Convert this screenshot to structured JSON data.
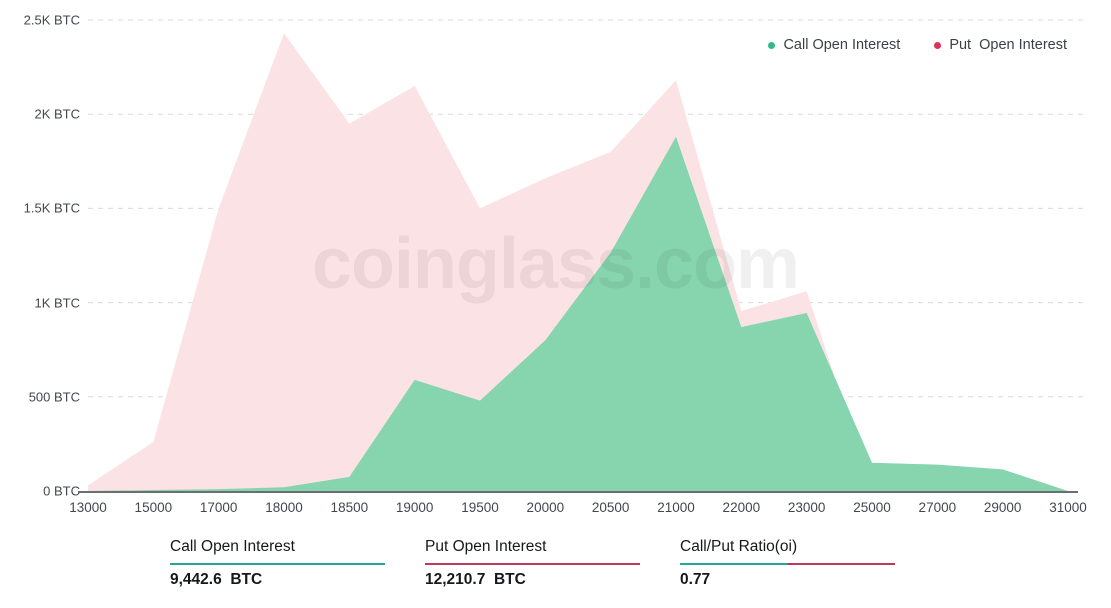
{
  "legend": {
    "items": [
      {
        "label": "Call Open Interest",
        "color": "#2ebd85",
        "icon": "dot-icon"
      },
      {
        "label": "Put  Open Interest",
        "color": "#e0315b",
        "icon": "dot-icon"
      }
    ]
  },
  "watermark": {
    "text": "coinglass.com"
  },
  "stats": [
    {
      "title": "Call Open Interest",
      "value": "9,442.6  BTC",
      "rule": "teal"
    },
    {
      "title": "Put Open Interest",
      "value": "12,210.7  BTC",
      "rule": "crimson"
    },
    {
      "title": "Call/Put Ratio(oi)",
      "value": "0.77",
      "rule": "split"
    }
  ],
  "colors": {
    "call_fill": "#86d5ae",
    "put_fill": "#fbe2e5",
    "call_accent": "#2ebd85",
    "put_accent": "#e0315b",
    "grid": "#d9d9d9",
    "axis": "#3c3f45",
    "teal_rule": "#26a69a",
    "crimson_rule": "#c0395a"
  },
  "chart_data": {
    "type": "area",
    "title": "",
    "xlabel": "",
    "ylabel": "",
    "grid": true,
    "legend_position": "top-right",
    "ylim": [
      0,
      2500
    ],
    "yticks": [
      0,
      500,
      1000,
      1500,
      2000,
      2500
    ],
    "ytick_labels": [
      "0 BTC",
      "500 BTC",
      "1K BTC",
      "1.5K BTC",
      "2K BTC",
      "2.5K BTC"
    ],
    "unit": "BTC",
    "categories": [
      "13000",
      "15000",
      "17000",
      "18000",
      "18500",
      "19000",
      "19500",
      "20000",
      "20500",
      "21000",
      "22000",
      "23000",
      "25000",
      "27000",
      "29000",
      "31000"
    ],
    "series": [
      {
        "name": "Call Open Interest",
        "color": "#86d5ae",
        "values": [
          0,
          5,
          10,
          20,
          75,
          590,
          480,
          800,
          1265,
          1880,
          870,
          945,
          150,
          140,
          115,
          0
        ]
      },
      {
        "name": "Put Open Interest",
        "color": "#fbe2e5",
        "values": [
          30,
          260,
          1500,
          2430,
          1950,
          2150,
          1500,
          1660,
          1800,
          2180,
          955,
          1060,
          0,
          0,
          0,
          0
        ]
      }
    ]
  }
}
